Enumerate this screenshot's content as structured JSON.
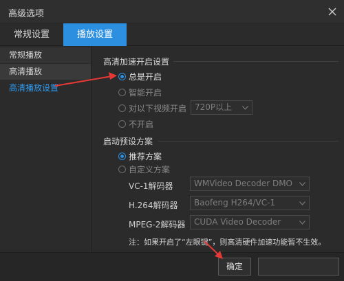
{
  "window": {
    "title": "高级选项",
    "close_icon": "close-icon"
  },
  "tabs": [
    {
      "label": "常规设置",
      "selected": false
    },
    {
      "label": "播放设置",
      "selected": true
    }
  ],
  "sidebar": {
    "items": [
      {
        "label": "常规播放"
      },
      {
        "label": "高清播放"
      },
      {
        "label": "高清播放设置",
        "active": true
      }
    ]
  },
  "hd_accel": {
    "group_label": "高清加速开启设置",
    "options": [
      {
        "label": "总是开启",
        "checked": true
      },
      {
        "label": "智能开启",
        "checked": false
      },
      {
        "label": "对以下视频开启",
        "checked": false
      },
      {
        "label": "不开启",
        "checked": false
      }
    ],
    "resolution_select": "720P以上"
  },
  "preset": {
    "group_label": "启动预设方案",
    "options": [
      {
        "label": "推荐方案",
        "checked": true
      },
      {
        "label": "自定义方案",
        "checked": false
      }
    ]
  },
  "decoders": [
    {
      "label": "VC-1解码器",
      "value": "WMVideo Decoder DMO"
    },
    {
      "label": "H.264解码器",
      "value": "Baofeng H264/VC-1"
    },
    {
      "label": "MPEG-2解码器",
      "value": "CUDA Video Decoder"
    }
  ],
  "note": "注：如果开启了“左眼键”，则高清硬件加速功能暂不生效。",
  "buttons": {
    "ok": "确定",
    "cancel": ""
  },
  "colors": {
    "accent": "#2d8fe0",
    "link": "#2f9bf0",
    "annotation_arrow": "#e53935"
  }
}
